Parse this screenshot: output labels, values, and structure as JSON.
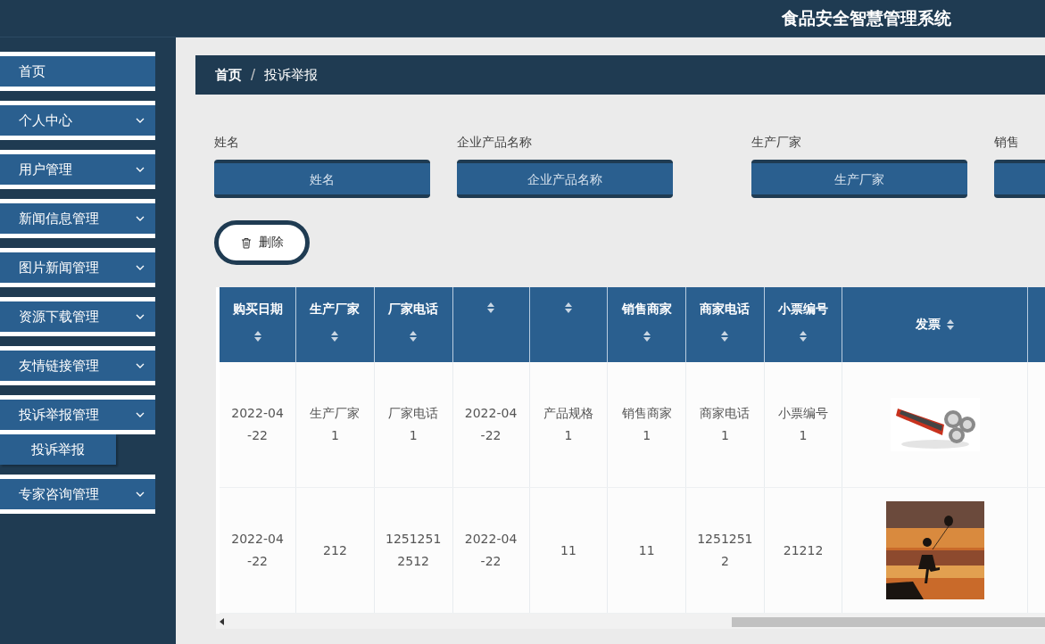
{
  "header": {
    "title": "食品安全智慧管理系统"
  },
  "sidebar": {
    "items": [
      {
        "label": "首页",
        "expandable": false,
        "expanded": false
      },
      {
        "label": "个人中心",
        "expandable": true,
        "expanded": false
      },
      {
        "label": "用户管理",
        "expandable": true,
        "expanded": false
      },
      {
        "label": "新闻信息管理",
        "expandable": true,
        "expanded": false
      },
      {
        "label": "图片新闻管理",
        "expandable": true,
        "expanded": false
      },
      {
        "label": "资源下载管理",
        "expandable": true,
        "expanded": false
      },
      {
        "label": "友情链接管理",
        "expandable": true,
        "expanded": false
      },
      {
        "label": "投诉举报管理",
        "expandable": true,
        "expanded": true,
        "children": [
          {
            "label": "投诉举报"
          }
        ]
      },
      {
        "label": "专家咨询管理",
        "expandable": true,
        "expanded": false
      }
    ]
  },
  "breadcrumb": {
    "separator": "/",
    "items": [
      {
        "label": "首页"
      },
      {
        "label": "投诉举报"
      }
    ]
  },
  "filters": [
    {
      "label": "姓名",
      "placeholder": "姓名"
    },
    {
      "label": "企业产品名称",
      "placeholder": "企业产品名称"
    },
    {
      "label": "生产厂家",
      "placeholder": "生产厂家"
    },
    {
      "label": "销售"
    }
  ],
  "delete_button": {
    "label": "删除"
  },
  "table": {
    "columns": [
      {
        "label": "购买日期",
        "kind": "text"
      },
      {
        "label": "生产厂家",
        "kind": "text"
      },
      {
        "label": "厂家电话",
        "kind": "text"
      },
      {
        "kind": "text"
      },
      {
        "kind": "text"
      },
      {
        "label": "销售商家",
        "kind": "text"
      },
      {
        "label": "商家电话",
        "kind": "text"
      },
      {
        "label": "小票编号",
        "kind": "text"
      },
      {
        "label": "发票"
      }
    ],
    "rows": [
      {
        "cells": [
          "2022-04-22",
          "生产厂家1",
          "厂家电话1",
          "2022-04-22",
          "产品规格1",
          "销售商家1",
          "商家电话1",
          "小票编号1"
        ]
      },
      {
        "cells": [
          "2022-04-22",
          "212",
          "12512512512",
          "2022-04-22",
          "11",
          "11",
          "12512512",
          "21212"
        ]
      }
    ]
  }
}
